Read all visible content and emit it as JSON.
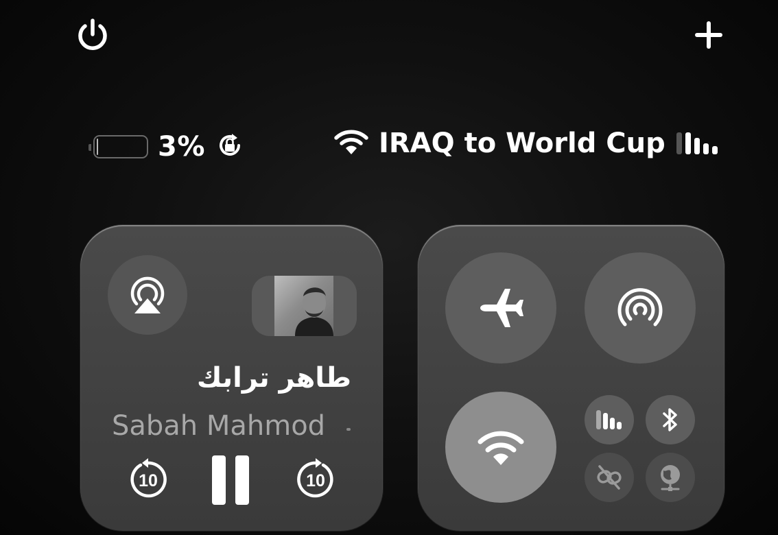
{
  "top_bar": {
    "power_icon": "power-icon",
    "add_icon": "plus-icon"
  },
  "status": {
    "battery_percent": "3%",
    "battery_level": 0.03,
    "rotation_lock_icon": "rotation-lock-icon",
    "wifi_name": "IRAQ to World Cup",
    "cellular_bars": 3
  },
  "media": {
    "song_title": "طاهر ترابك",
    "artist": "Sabah Mahmod",
    "skip_back_label": "10",
    "skip_forward_label": "10",
    "airplay_icon": "airplay-audio-icon",
    "artwork": "album-artwork"
  },
  "connectivity": {
    "airplane_mode": {
      "icon": "airplane-icon",
      "on": false
    },
    "airdrop": {
      "icon": "airdrop-icon",
      "on": false
    },
    "wifi": {
      "icon": "wifi-icon",
      "on": true
    },
    "cellular": {
      "icon": "cellular-icon",
      "on": false
    },
    "bluetooth": {
      "icon": "bluetooth-icon",
      "on": false
    },
    "personal_hotspot": {
      "icon": "link-slash-icon",
      "on": false
    },
    "vpn": {
      "icon": "globe-network-icon",
      "on": false
    }
  }
}
